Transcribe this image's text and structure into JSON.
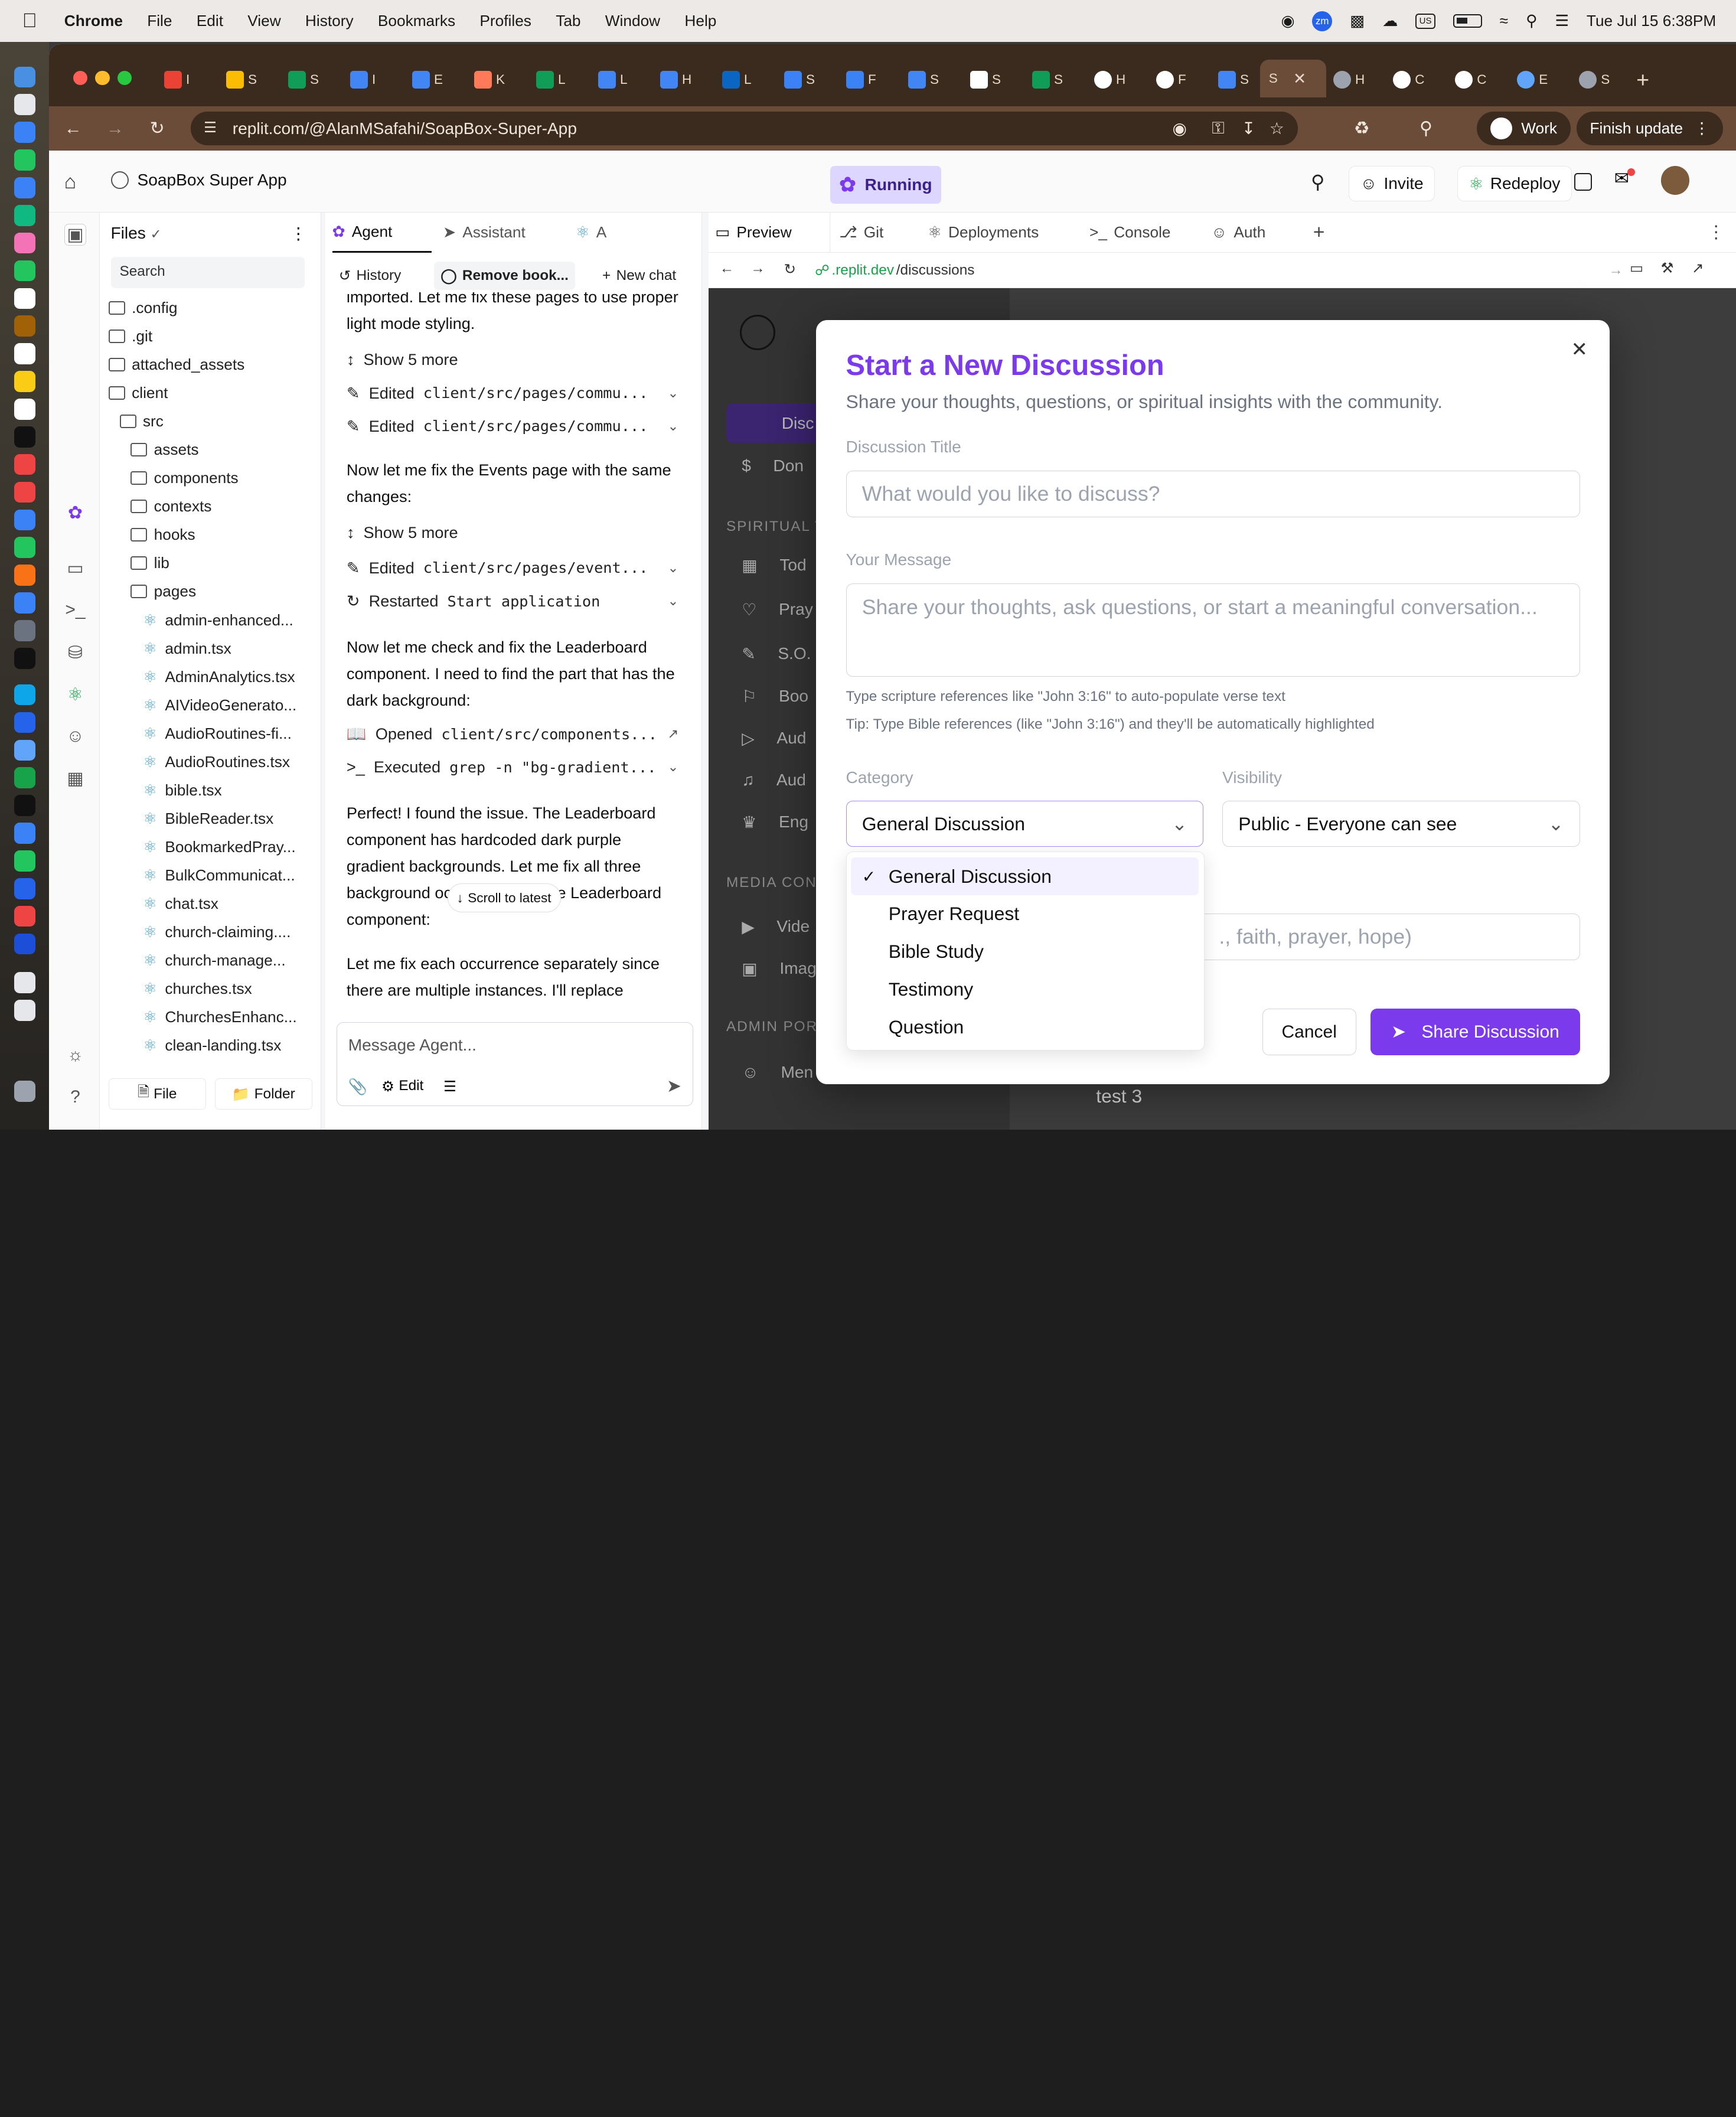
{
  "menubar": {
    "app": "Chrome",
    "items": [
      "File",
      "Edit",
      "View",
      "History",
      "Bookmarks",
      "Profiles",
      "Tab",
      "Window",
      "Help"
    ],
    "input_source": "US",
    "datetime": "Tue Jul 15  6:38PM"
  },
  "browser": {
    "active_tab": "S",
    "url": "replit.com/@AlanMSafahi/SoapBox-Super-App",
    "profile": "Work",
    "finish_update": "Finish update",
    "tabs": [
      "I",
      "S",
      "S",
      "I",
      "E",
      "K",
      "L",
      "L",
      "H",
      "L",
      "S",
      "F",
      "S",
      "S",
      "S",
      "H",
      "F",
      "S",
      "S",
      "H",
      "C",
      "C",
      "E",
      "S"
    ]
  },
  "replit": {
    "project": "SoapBox Super App",
    "status": "Running",
    "invite": "Invite",
    "redeploy": "Redeploy"
  },
  "files": {
    "title": "Files",
    "search_placeholder": "Search",
    "new_file": "File",
    "new_folder": "Folder",
    "tree": [
      ".config",
      ".git",
      "attached_assets",
      "client",
      "src",
      "assets",
      "components",
      "contexts",
      "hooks",
      "lib",
      "pages"
    ],
    "pages": [
      "admin-enhanced...",
      "admin.tsx",
      "AdminAnalytics.tsx",
      "AIVideoGenerato...",
      "AudioRoutines-fi...",
      "AudioRoutines.tsx",
      "bible.tsx",
      "BibleReader.tsx",
      "BookmarkedPray...",
      "BulkCommunicat...",
      "chat.tsx",
      "church-claiming....",
      "church-manage...",
      "churches.tsx",
      "ChurchesEnhanc...",
      "clean-landing.tsx"
    ]
  },
  "agent": {
    "tabs": [
      "Agent",
      "Assistant",
      "A"
    ],
    "history": "History",
    "current_chat": "Remove book...",
    "new_chat": "New chat",
    "msg1": "imported. Let me fix these pages to use proper light mode styling.",
    "show_more": "Show 5 more",
    "edited": "Edited",
    "file_commu": "client/src/pages/commu...",
    "file_event": "client/src/pages/event...",
    "msg2": "Now let me fix the Events page with the same changes:",
    "restarted": "Restarted",
    "restart_target": "Start application",
    "msg3": "Now let me check and fix the Leaderboard component. I need to find the part that has the dark background:",
    "opened": "Opened",
    "opened_file": "client/src/components...",
    "executed": "Executed",
    "executed_cmd": "grep -n \"bg-gradient...",
    "msg4": "Perfect! I found the issue. The Leaderboard component has hardcoded dark purple gradient backgrounds. Let me fix all three background occurrences in the Leaderboard component:",
    "msg5": "Let me fix each occurrence separately since there are multiple instances. I'll replace",
    "scroll_latest": "Scroll to latest",
    "message_placeholder": "Message Agent...",
    "edit": "Edit"
  },
  "preview": {
    "tabs": [
      "Preview",
      "Git",
      "Deployments",
      "Console",
      "Auth"
    ],
    "url_prefix": ".replit.dev",
    "url_path": "/discussions"
  },
  "modal": {
    "title": "Start a New Discussion",
    "subtitle": "Share your thoughts, questions, or spiritual insights with the community.",
    "title_label": "Discussion Title",
    "title_placeholder": "What would you like to discuss?",
    "message_label": "Your Message",
    "message_placeholder": "Share your thoughts, ask questions, or start a meaningful conversation...",
    "hint1": "Type scripture references like \"John 3:16\" to auto-populate verse text",
    "hint2": "Tip: Type Bible references (like \"John 3:16\") and they'll be automatically highlighted",
    "category_label": "Category",
    "category_value": "General Discussion",
    "visibility_label": "Visibility",
    "visibility_value": "Public - Everyone can see",
    "tags_placeholder_partial": "., faith, prayer, hope)",
    "options": [
      "General Discussion",
      "Prayer Request",
      "Bible Study",
      "Testimony",
      "Question"
    ],
    "cancel": "Cancel",
    "submit": "Share Discussion",
    "accent": "#7c3aed"
  },
  "background_page": {
    "nav_partial": [
      "Disc",
      "Don",
      "SPIRITUAL T",
      "Tod",
      "Pray",
      "S.O.",
      "Boo",
      "Aud",
      "Aud",
      "Eng",
      "MEDIA CONT",
      "Vide",
      "Imag",
      "ADMIN PORT",
      "Men"
    ],
    "item": "test 3"
  }
}
